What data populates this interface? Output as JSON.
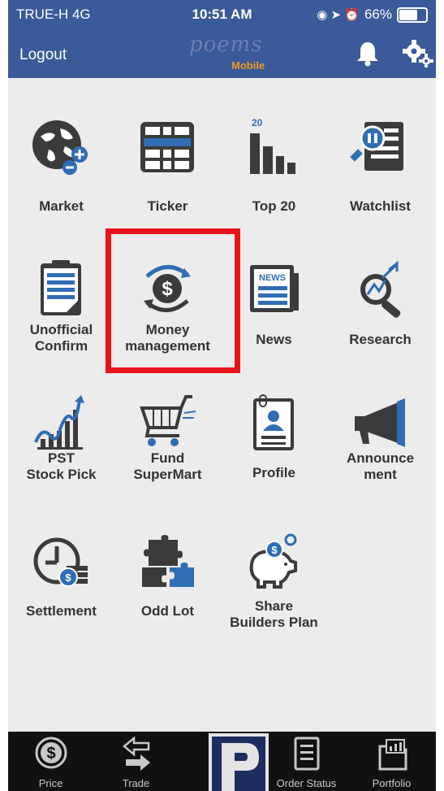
{
  "status_bar": {
    "carrier": "TRUE-H  4G",
    "time": "10:51 AM",
    "battery": "66%"
  },
  "header": {
    "logout_label": "Logout",
    "logo_text": "poems",
    "logo_sub": "Mobile"
  },
  "tiles": {
    "market": "Market",
    "ticker": "Ticker",
    "top20": "Top 20",
    "top20_badge": "20",
    "watchlist": "Watchlist",
    "unofficial_1": "Unofficial",
    "unofficial_2": "Confirm",
    "money_1": "Money",
    "money_2": "management",
    "news": "News",
    "news_badge": "NEWS",
    "research": "Research",
    "pst_1": "PST",
    "pst_2": "Stock Pick",
    "fund_1": "Fund",
    "fund_2": "SuperMart",
    "profile": "Profile",
    "announce_1": "Announce",
    "announce_2": "ment",
    "settlement": "Settlement",
    "oddlot": "Odd Lot",
    "share_1": "Share",
    "share_2": "Builders Plan"
  },
  "tabbar": {
    "price": "Price",
    "trade": "Trade",
    "order_status": "Order Status",
    "portfolio": "Portfolio"
  },
  "colors": {
    "header_bg": "#3a5a99",
    "icon_dark": "#3a3a3a",
    "icon_blue": "#2f6db5",
    "highlight": "#e8141b",
    "tabbar_bg": "#111111"
  }
}
